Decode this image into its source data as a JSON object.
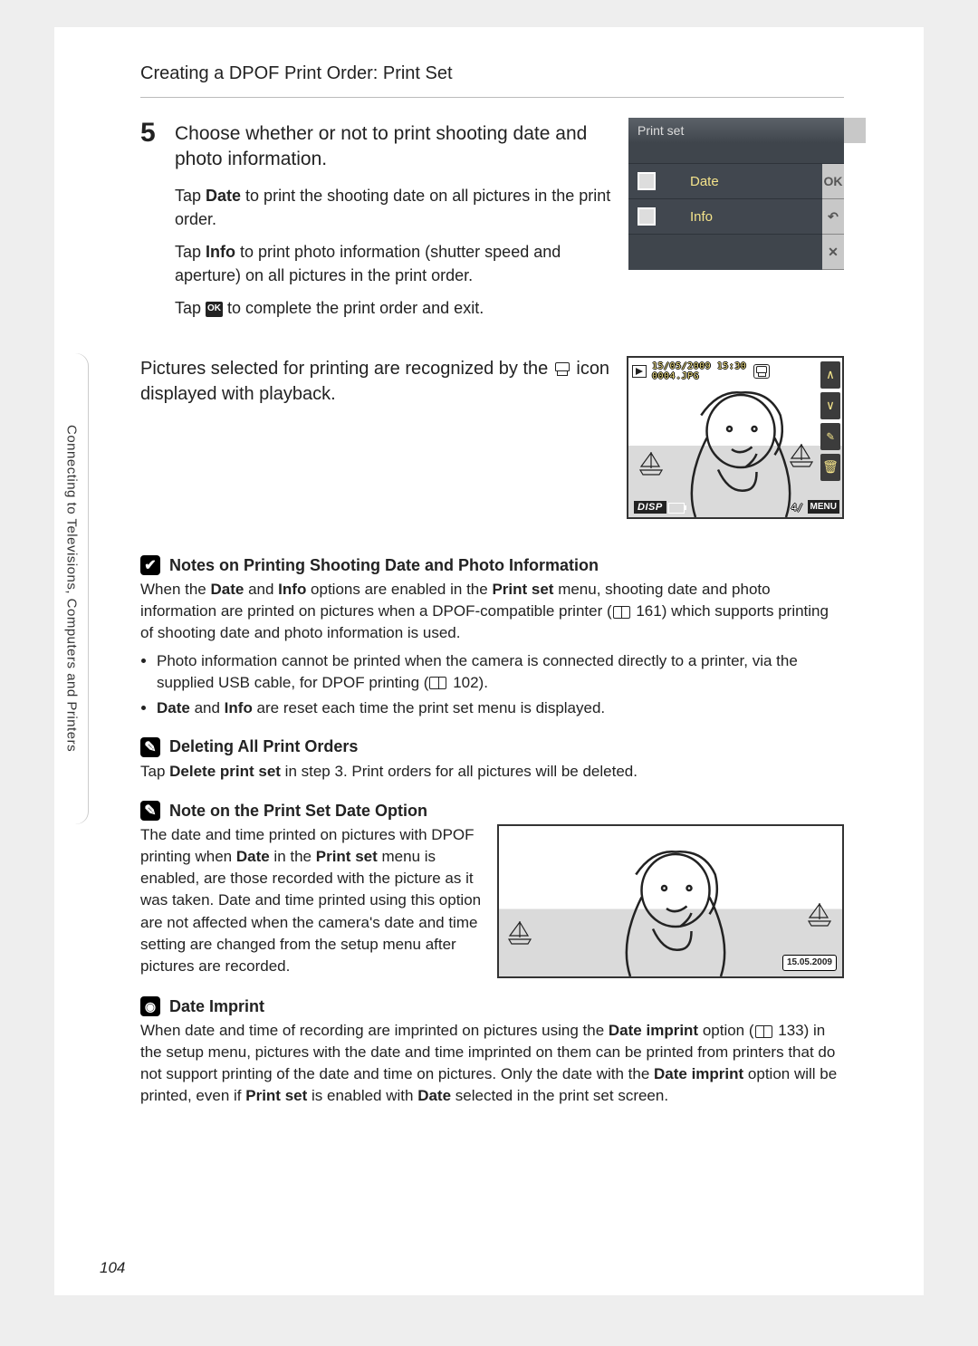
{
  "header": "Creating a DPOF Print Order: Print Set",
  "sideTab": "Connecting to Televisions, Computers and Printers",
  "pageNum": "104",
  "step": {
    "num": "5",
    "title": "Choose whether or not to print shooting date and photo information.",
    "p1a": "Tap ",
    "p1b": "Date",
    "p1c": " to print the shooting date on all pictures in the print order.",
    "p2a": "Tap ",
    "p2b": "Info",
    "p2c": " to print photo information (shutter speed and aperture) on all pictures in the print order.",
    "p3a": "Tap ",
    "p3b": " to complete the print order and exit.",
    "ok": "OK"
  },
  "preview1": {
    "title": "Print set",
    "date": "Date",
    "info": "Info",
    "ok": "OK",
    "back": "↶",
    "close": "✕"
  },
  "playback": {
    "a": "Pictures selected for printing are recognized by the ",
    "b": " icon displayed with playback.",
    "line1": "15/05/2009 15:30",
    "line2": "0004.JPG",
    "disp": "DISP",
    "menu": "MENU",
    "counter": "4/   4"
  },
  "notes": {
    "title": "Notes on Printing Shooting Date and Photo Information",
    "body1a": "When the ",
    "body1b": "Date",
    "body1c": " and ",
    "body1d": "Info",
    "body1e": " options are enabled in the ",
    "body1f": "Print set",
    "body1g": " menu, shooting date and photo information are printed on pictures when a DPOF-compatible printer (",
    "body1h": " 161) which supports printing of shooting date and photo information is used.",
    "li1a": "Photo information cannot be printed when the camera is connected directly to a printer, via the supplied USB cable, for DPOF printing (",
    "li1b": " 102).",
    "li2a": "Date",
    "li2b": " and ",
    "li2c": "Info",
    "li2d": " are reset each time the print set menu is displayed."
  },
  "del": {
    "title": "Deleting All Print Orders",
    "a": "Tap ",
    "b": "Delete print set",
    "c": " in step 3. Print orders for all pictures will be deleted."
  },
  "dateopt": {
    "title": "Note on the Print Set Date Option",
    "a": "The date and time printed on pictures with DPOF printing when ",
    "b": "Date",
    "c": " in the ",
    "d": "Print set",
    "e": " menu is enabled, are those recorded with the picture as it was taken. Date and time printed using this option are not affected when the camera's date and time setting are changed from the setup menu after pictures are recorded.",
    "badge": "15.05.2009"
  },
  "imprint": {
    "title": "Date Imprint",
    "a": "When date and time of recording are imprinted on pictures using the ",
    "b": "Date imprint",
    "c": " option (",
    "d": " 133) in the setup menu, pictures with the date and time imprinted on them can be printed from printers that do not support printing of the date and time on pictures. Only the date with the ",
    "e": "Date imprint",
    "f": " option will be printed, even if ",
    "g": "Print set",
    "h": " is enabled with ",
    "i": "Date",
    "j": " selected in the print set screen."
  }
}
